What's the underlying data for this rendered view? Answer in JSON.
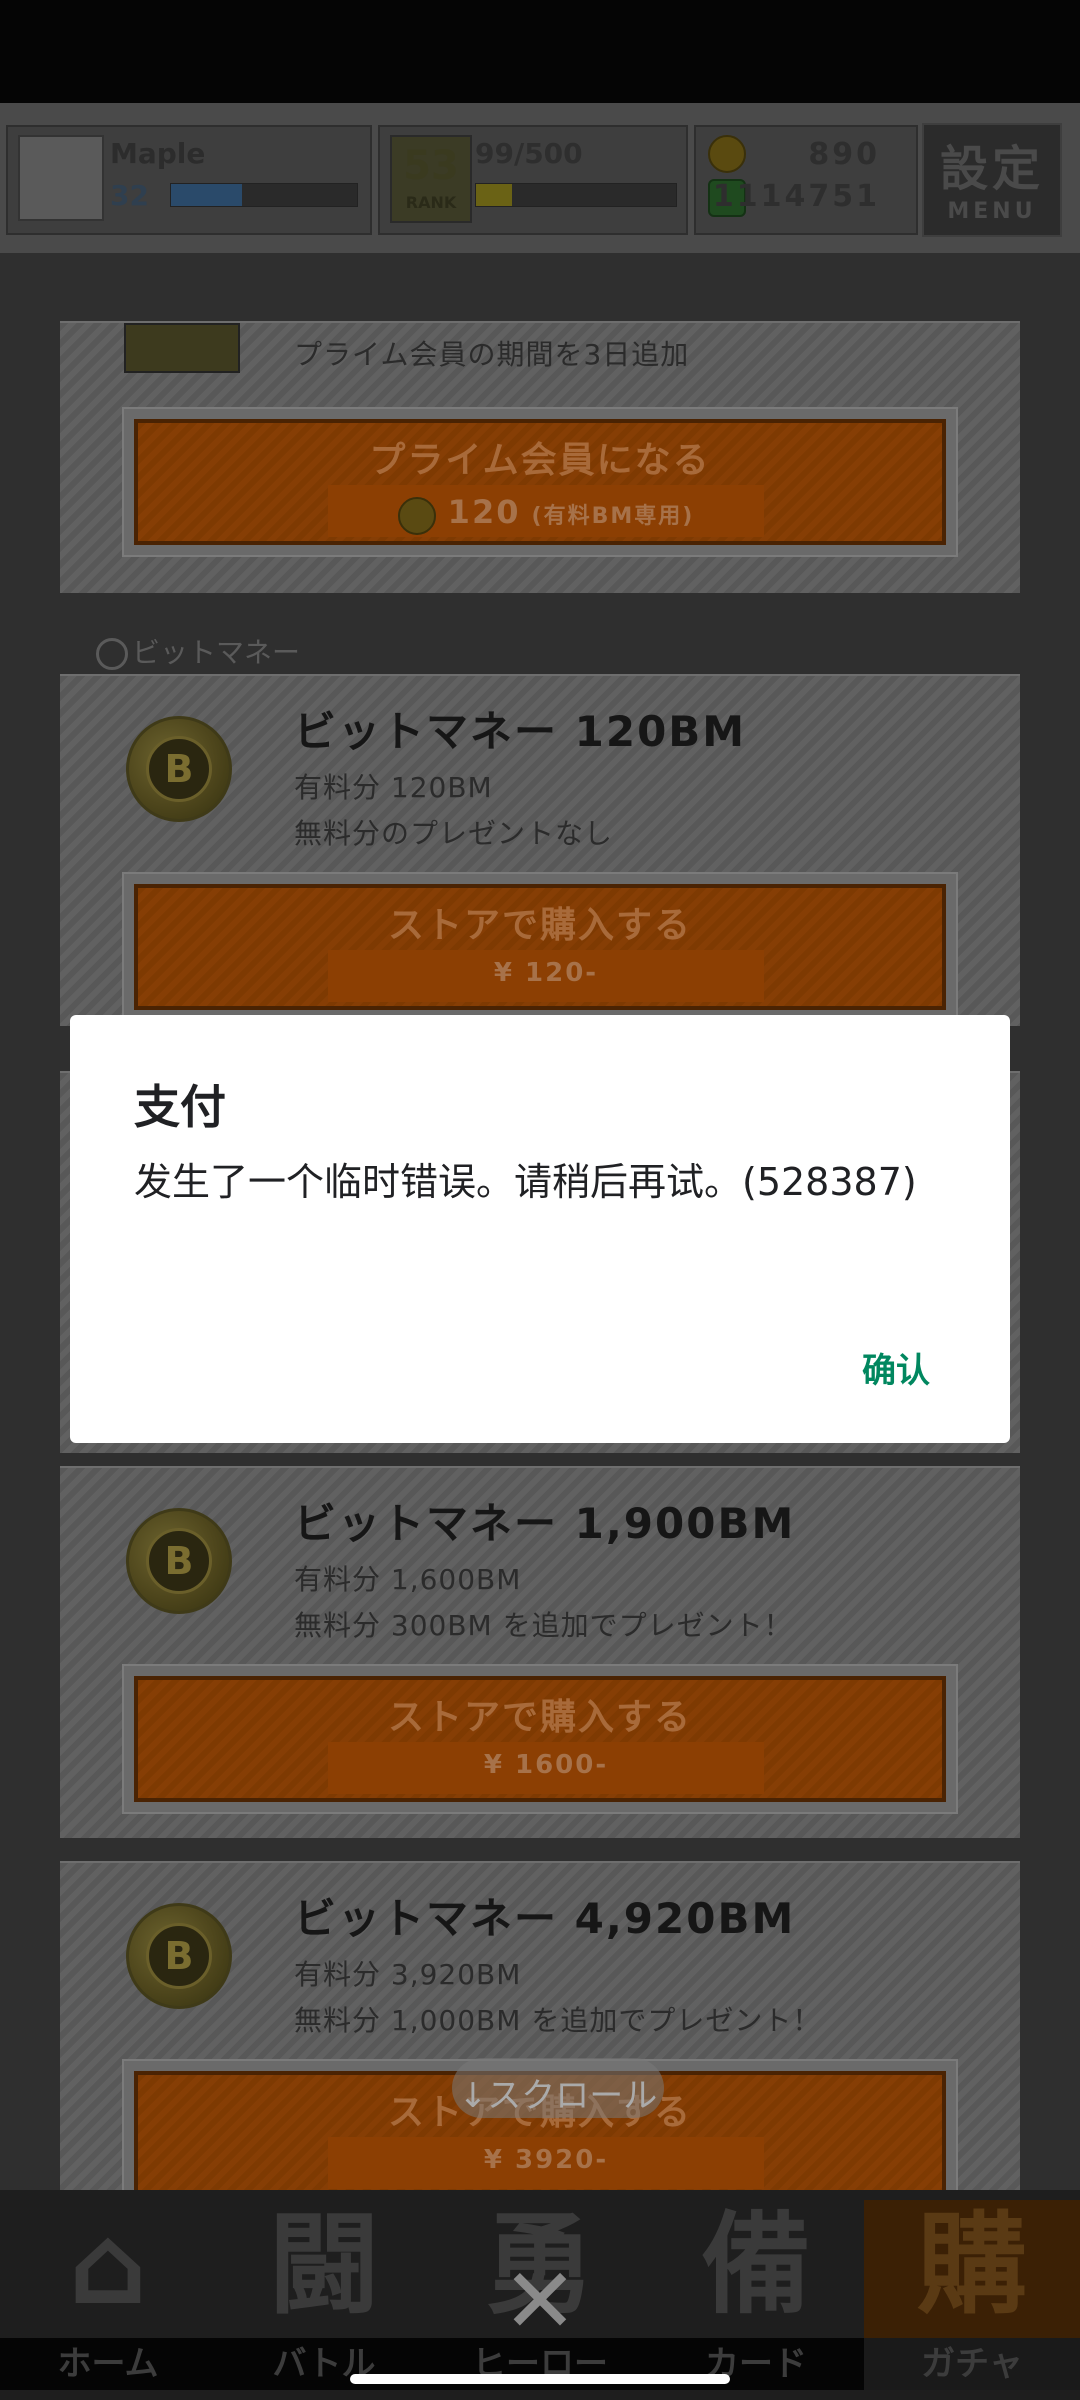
{
  "header": {
    "player_name": "Maple",
    "player_level": "32",
    "rank_number": "53",
    "rank_label": "RANK",
    "stamina": "99/500",
    "bm_amount": "890",
    "coin_amount": "1114751",
    "menu_kanji": "設定",
    "menu_label": "MENU",
    "colors": {
      "exp_bar": "#2a4a6a",
      "stamina_bar": "#6a6215"
    }
  },
  "prime": {
    "subtitle": "プライム会員の期間を3日追加",
    "button_label": "プライム会員になる",
    "price": "120",
    "price_note": "(有料BM専用)"
  },
  "section": {
    "title": "ビットマネー"
  },
  "items": [
    {
      "title": "ビットマネー 120BM",
      "paid": "有料分 120BM",
      "bonus": "無料分のプレゼントなし",
      "button_label": "ストアで購入する",
      "price": "¥ 120-"
    },
    {
      "title": "ビットマネー 1,900BM",
      "paid": "有料分 1,600BM",
      "bonus": "無料分 300BM を追加でプレゼント！",
      "button_label": "ストアで購入する",
      "price": "¥ 1600-"
    },
    {
      "title": "ビットマネー 4,920BM",
      "paid": "有料分 3,920BM",
      "bonus": "無料分 1,000BM を追加でプレゼント！",
      "button_label": "ストアで購入する",
      "price": "¥ 3920-"
    }
  ],
  "scroll_hint": "↓スクロール",
  "nav": [
    {
      "label": "ホーム",
      "icon": "home-icon",
      "glyph": "⌂"
    },
    {
      "label": "バトル",
      "icon": "battle-icon",
      "glyph": "闘"
    },
    {
      "label": "ヒーロー",
      "icon": "hero-icon",
      "glyph": "勇"
    },
    {
      "label": "カード",
      "icon": "card-icon",
      "glyph": "備"
    },
    {
      "label": "ガチャ",
      "icon": "gacha-icon",
      "glyph": "購"
    }
  ],
  "dialog": {
    "title": "支付",
    "message": "发生了一个临时错误。请稍后再试。(528387)",
    "confirm_label": "确认",
    "accent_color": "#01875f"
  }
}
